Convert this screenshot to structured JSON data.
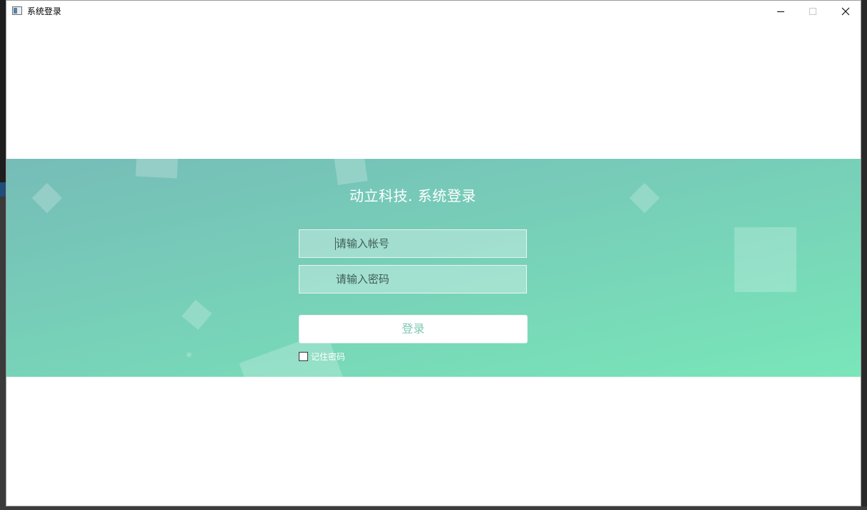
{
  "window": {
    "title": "系统登录"
  },
  "login": {
    "title": "动立科技. 系统登录",
    "account_placeholder": "请输入帐号",
    "password_placeholder": "请输入密码",
    "submit_label": "登录",
    "remember_label": "记住密码",
    "remember_checked": false
  },
  "colors": {
    "banner_start": "#76bcb8",
    "banner_end": "#79e6b9",
    "button_text": "#7fc9b3"
  }
}
